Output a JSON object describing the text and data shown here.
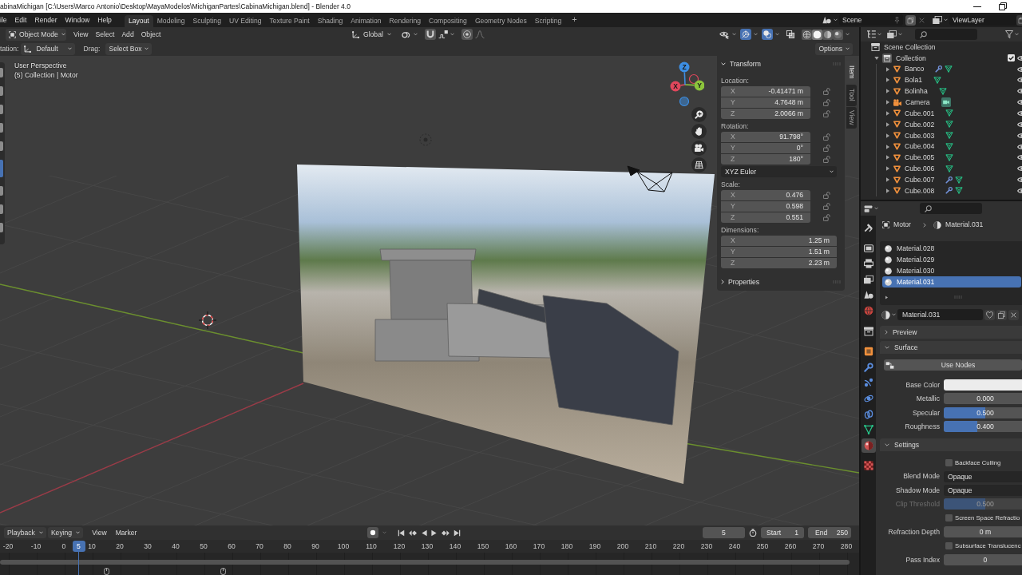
{
  "window": {
    "title": "abinaMichigan [C:\\Users\\Marco Antonio\\Desktop\\MayaModelos\\MichiganPartes\\CabinaMichigan.blend] - Blender 4.0"
  },
  "menu": [
    "ile",
    "Edit",
    "Render",
    "Window",
    "Help"
  ],
  "workspaces": [
    {
      "label": "Layout",
      "selected": true
    },
    {
      "label": "Modeling",
      "selected": false
    },
    {
      "label": "Sculpting",
      "selected": false
    },
    {
      "label": "UV Editing",
      "selected": false
    },
    {
      "label": "Texture Paint",
      "selected": false
    },
    {
      "label": "Shading",
      "selected": false
    },
    {
      "label": "Animation",
      "selected": false
    },
    {
      "label": "Rendering",
      "selected": false
    },
    {
      "label": "Compositing",
      "selected": false
    },
    {
      "label": "Geometry Nodes",
      "selected": false
    },
    {
      "label": "Scripting",
      "selected": false
    }
  ],
  "add_workspace": "+",
  "scene": {
    "name": "Scene"
  },
  "view_layer": {
    "name": "ViewLayer"
  },
  "viewport_header": {
    "mode": "Object Mode",
    "menus": [
      "View",
      "Select",
      "Add",
      "Object"
    ],
    "orientation": "Global",
    "toggles": [
      {
        "kind": "gizmos",
        "on": true
      },
      {
        "kind": "overlays",
        "on": true
      },
      {
        "kind": "xray",
        "on": false
      }
    ],
    "shading": [
      {
        "kind": "wireframe",
        "selected": false
      },
      {
        "kind": "solid",
        "selected": true
      },
      {
        "kind": "material",
        "selected": false
      },
      {
        "kind": "rendered",
        "selected": false
      }
    ]
  },
  "tool_settings": {
    "orientation_label": "tation:",
    "orientation": "Default",
    "drag_label": "Drag:",
    "drag": "Select Box",
    "options": "Options"
  },
  "toolbar": [
    {
      "selected": false
    },
    {
      "selected": false
    },
    {
      "selected": false
    },
    {
      "selected": false
    },
    {
      "selected": false
    },
    {
      "selected": true
    },
    {
      "selected": false
    },
    {
      "selected": false
    },
    {
      "selected": false
    }
  ],
  "viewport": {
    "perspective": "User Perspective",
    "context": "(5) Collection | Motor",
    "gizmo": [
      {
        "label": "X",
        "color": "#e0475c"
      },
      {
        "label": "Y",
        "color": "#8cc43c"
      },
      {
        "label": "Z",
        "color": "#3d8fe4"
      }
    ]
  },
  "sidebar": {
    "panels": [
      {
        "title": "Transform",
        "expanded": true,
        "groups": [
          {
            "label": "Location:",
            "locks": true,
            "fields": [
              {
                "axis": "X",
                "value": "-0.41471 m"
              },
              {
                "axis": "Y",
                "value": "4.7648 m"
              },
              {
                "axis": "Z",
                "value": "2.0066 m"
              }
            ]
          },
          {
            "label": "Rotation:",
            "locks": true,
            "fields": [
              {
                "axis": "X",
                "value": "91.798°"
              },
              {
                "axis": "Y",
                "value": "0°"
              },
              {
                "axis": "Z",
                "value": "180°"
              }
            ],
            "mode": "XYZ Euler"
          },
          {
            "label": "Scale:",
            "locks": true,
            "fields": [
              {
                "axis": "X",
                "value": "0.476"
              },
              {
                "axis": "Y",
                "value": "0.598"
              },
              {
                "axis": "Z",
                "value": "0.551"
              }
            ]
          },
          {
            "label": "Dimensions:",
            "locks": false,
            "fields": [
              {
                "axis": "X",
                "value": "1.25 m"
              },
              {
                "axis": "Y",
                "value": "1.51 m"
              },
              {
                "axis": "Z",
                "value": "2.23 m"
              }
            ]
          }
        ]
      },
      {
        "title": "Properties",
        "expanded": false
      }
    ],
    "tabs": [
      {
        "label": "Item",
        "selected": true
      },
      {
        "label": "Tool",
        "selected": false
      },
      {
        "label": "View",
        "selected": false
      }
    ]
  },
  "outliner": {
    "tree": [
      {
        "name": "Scene Collection",
        "kind": "scene_collection",
        "children": [
          {
            "name": "Collection",
            "kind": "collection",
            "expanded": true,
            "checked": true,
            "children": [
              {
                "name": "Banco",
                "kind": "mesh",
                "expanded": false,
                "modifiers": true
              },
              {
                "name": "Bola1",
                "kind": "mesh",
                "expanded": false,
                "modifiers": false
              },
              {
                "name": "Bolinha",
                "kind": "mesh",
                "expanded": false,
                "modifiers": false
              },
              {
                "name": "Camera",
                "kind": "camera",
                "expanded": false,
                "modifiers": false
              },
              {
                "name": "Cube.001",
                "kind": "mesh",
                "expanded": false,
                "modifiers": false
              },
              {
                "name": "Cube.002",
                "kind": "mesh",
                "expanded": false,
                "modifiers": false
              },
              {
                "name": "Cube.003",
                "kind": "mesh",
                "expanded": false,
                "modifiers": false
              },
              {
                "name": "Cube.004",
                "kind": "mesh",
                "expanded": false,
                "modifiers": false
              },
              {
                "name": "Cube.005",
                "kind": "mesh",
                "expanded": false,
                "modifiers": false
              },
              {
                "name": "Cube.006",
                "kind": "mesh",
                "expanded": false,
                "modifiers": false
              },
              {
                "name": "Cube.007",
                "kind": "mesh",
                "expanded": false,
                "modifiers": true
              },
              {
                "name": "Cube.008",
                "kind": "mesh",
                "expanded": false,
                "modifiers": true
              }
            ]
          }
        ]
      }
    ]
  },
  "properties": {
    "tabs": [
      {
        "kind": "tool",
        "selected": false
      },
      {
        "kind": "render",
        "selected": false
      },
      {
        "kind": "output",
        "selected": false
      },
      {
        "kind": "view_layer",
        "selected": false
      },
      {
        "kind": "scene",
        "selected": false
      },
      {
        "kind": "world",
        "selected": false
      },
      {
        "kind": "collection",
        "selected": false
      },
      {
        "kind": "object",
        "selected": false
      },
      {
        "kind": "modifiers",
        "selected": false
      },
      {
        "kind": "particles",
        "selected": false
      },
      {
        "kind": "physics",
        "selected": false
      },
      {
        "kind": "constraints",
        "selected": false
      },
      {
        "kind": "data",
        "selected": false
      },
      {
        "kind": "material",
        "selected": true
      },
      {
        "kind": "texture",
        "selected": false
      }
    ],
    "breadcrumb": {
      "object": "Motor",
      "material": "Material.031"
    },
    "slots": [
      {
        "name": "Material.028",
        "selected": false
      },
      {
        "name": "Material.029",
        "selected": false
      },
      {
        "name": "Material.030",
        "selected": false
      },
      {
        "name": "Material.031",
        "selected": true
      }
    ],
    "material": "Material.031",
    "panels": [
      {
        "title": "Preview",
        "expanded": false
      },
      {
        "title": "Surface",
        "expanded": true,
        "rows": [
          {
            "kind": "button",
            "label": "Use Nodes",
            "disabled": false
          },
          {
            "kind": "color",
            "label": "Base Color",
            "color": "#ececec",
            "disabled": false
          },
          {
            "kind": "number",
            "label": "Metallic",
            "value": "0.000",
            "disabled": false
          },
          {
            "kind": "slider",
            "label": "Specular",
            "value": "0.500",
            "level": 0.5,
            "disabled": false
          },
          {
            "kind": "slider",
            "label": "Roughness",
            "value": "0.400",
            "level": 0.4,
            "disabled": false
          }
        ]
      },
      {
        "title": "Settings",
        "expanded": true,
        "rows": [
          {
            "kind": "checkbox",
            "label": "Backface Culling",
            "checked": false,
            "disabled": false
          },
          {
            "kind": "dropdown",
            "label": "Blend Mode",
            "value": "Opaque",
            "disabled": false
          },
          {
            "kind": "dropdown",
            "label": "Shadow Mode",
            "value": "Opaque",
            "disabled": false
          },
          {
            "kind": "slider",
            "label": "Clip Threshold",
            "value": "0.500",
            "level": 0.5,
            "disabled": true
          },
          {
            "kind": "checkbox",
            "label": "Screen Space Refractio",
            "checked": false,
            "disabled": false
          },
          {
            "kind": "number",
            "label": "Refraction Depth",
            "value": "0 m",
            "disabled": false
          },
          {
            "kind": "checkbox",
            "label": "Subsurface Translucenc",
            "checked": false,
            "disabled": false
          },
          {
            "kind": "number",
            "label": "Pass Index",
            "value": "0",
            "disabled": false
          }
        ]
      }
    ]
  },
  "timeline": {
    "menus": [
      {
        "label": "Playback",
        "kind": "dropdown"
      },
      {
        "label": "Keying",
        "kind": "dropdown"
      },
      {
        "label": "View",
        "kind": "menu"
      },
      {
        "label": "Marker",
        "kind": "menu"
      }
    ],
    "frame": "5",
    "start_label": "Start",
    "start": "1",
    "end_label": "End",
    "end": "250",
    "ticks": [
      "-20",
      "-10",
      "0",
      "10",
      "20",
      "30",
      "40",
      "50",
      "60",
      "70",
      "80",
      "90",
      "100",
      "110",
      "120",
      "130",
      "140",
      "150",
      "160",
      "170",
      "180",
      "190",
      "200",
      "210",
      "220",
      "230",
      "240",
      "250",
      "260",
      "270",
      "280"
    ],
    "playhead": "5"
  }
}
